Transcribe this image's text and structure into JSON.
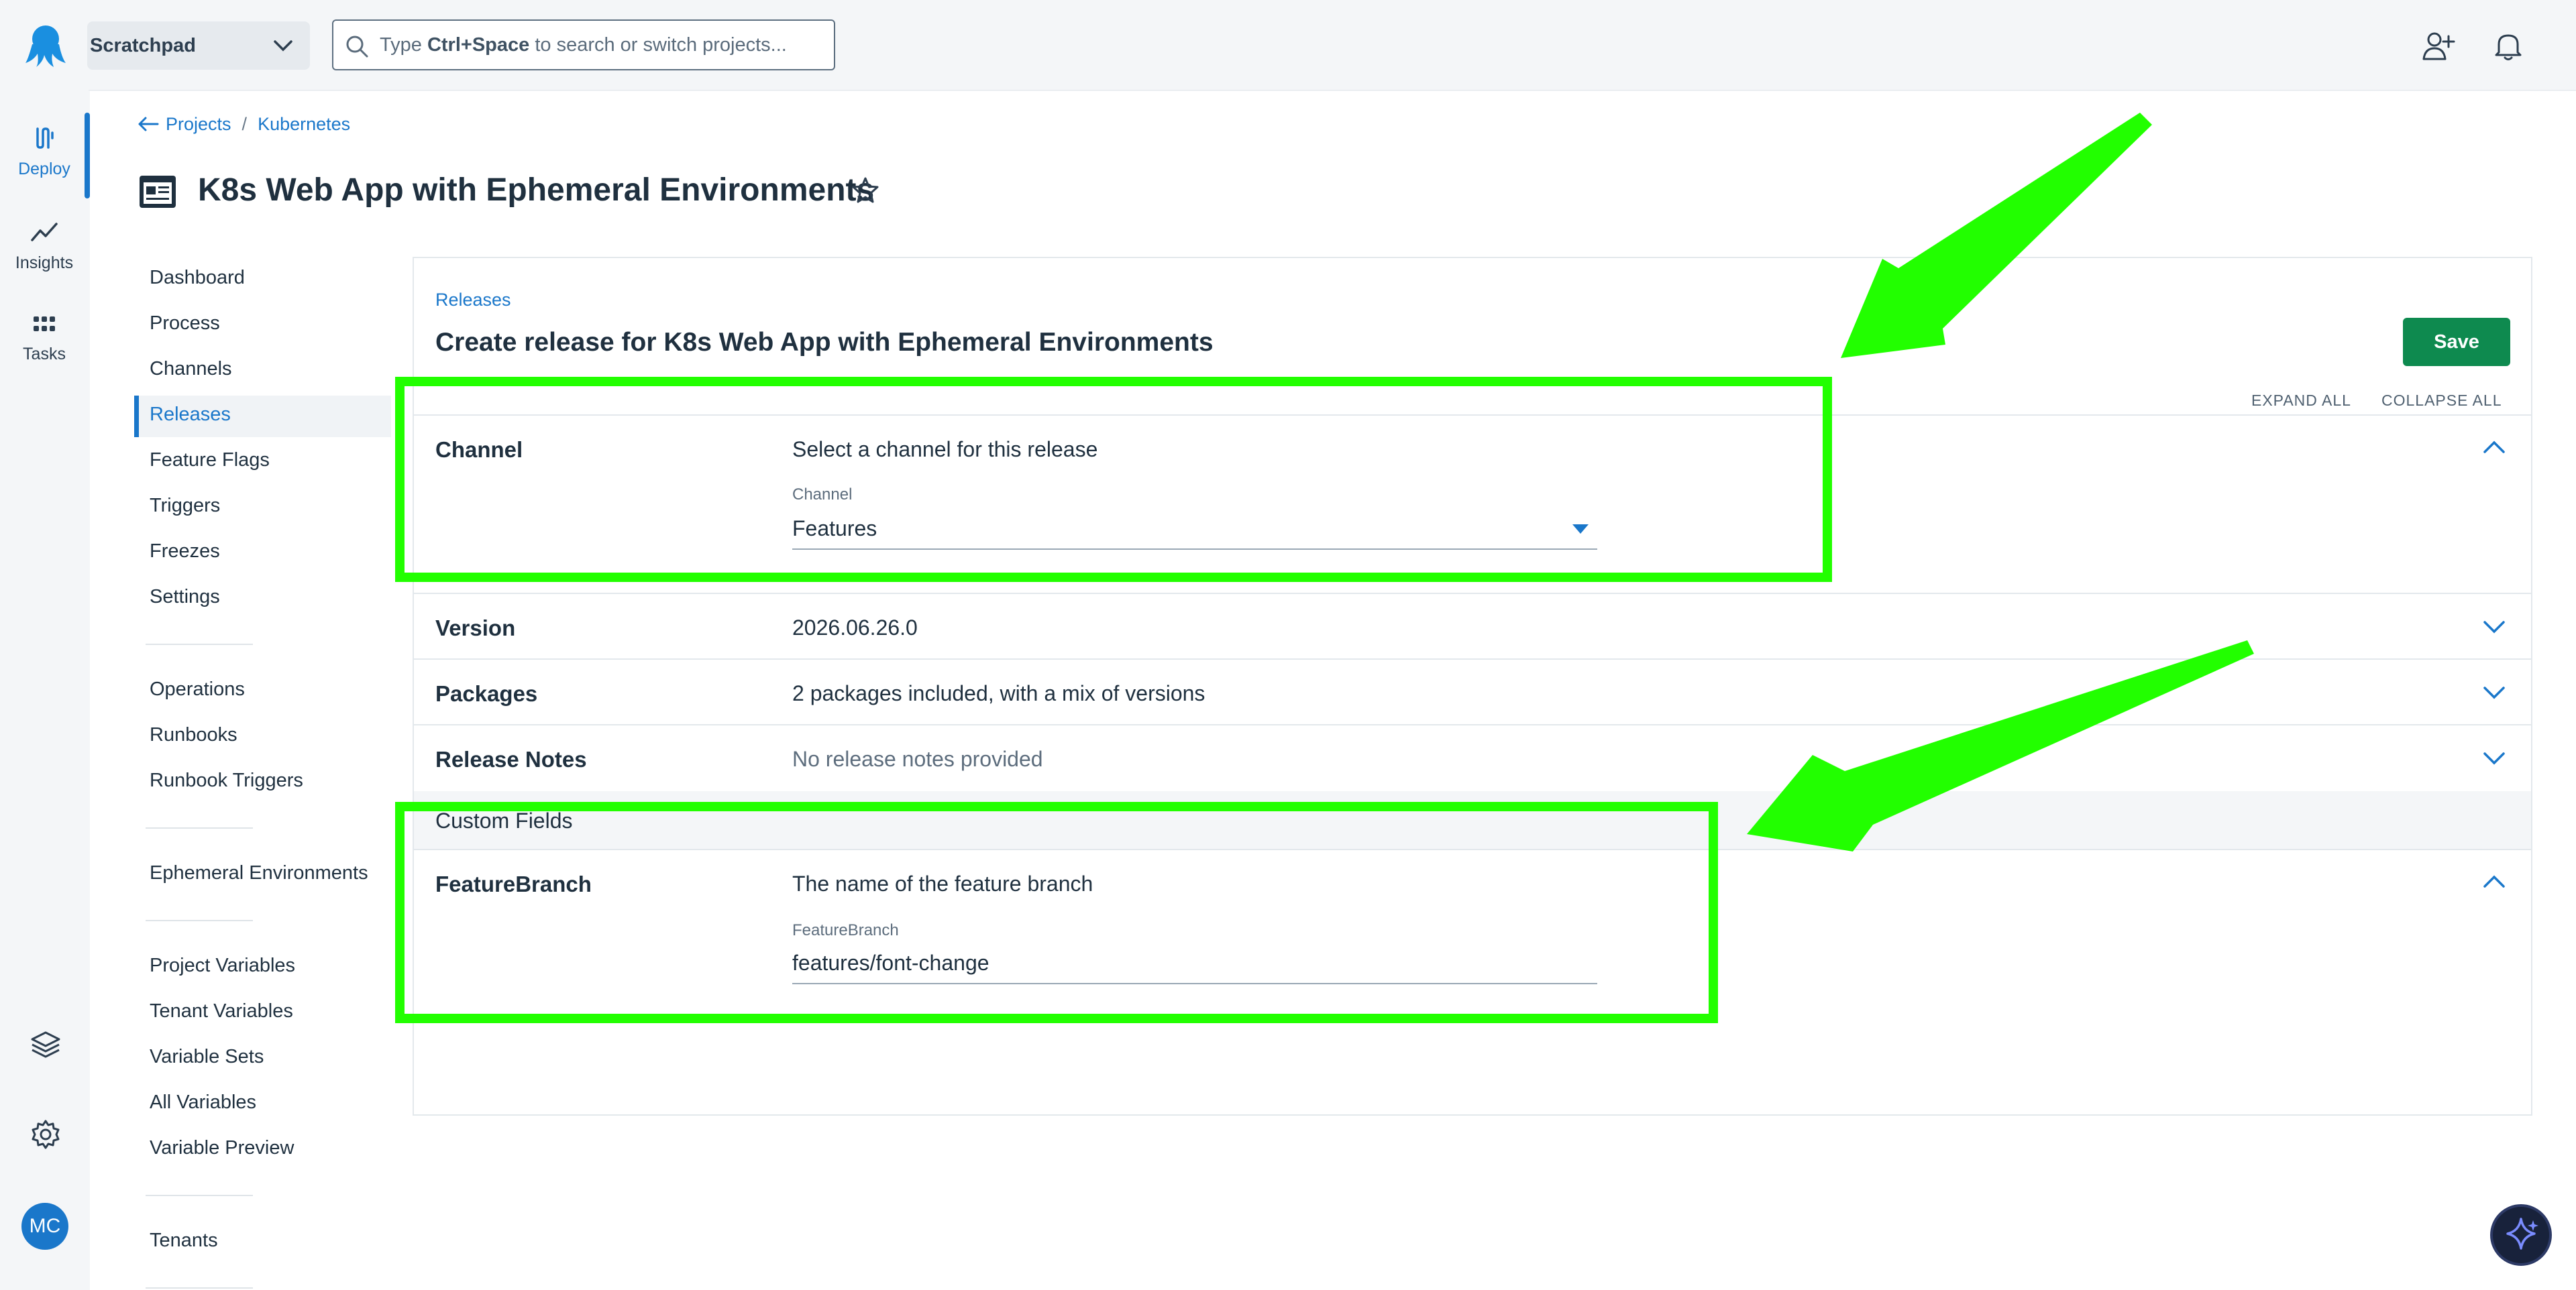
{
  "topbar": {
    "space_name": "Scratchpad",
    "search_prefix": "Type ",
    "search_shortcut": "Ctrl+Space",
    "search_suffix": " to search or switch projects..."
  },
  "rail": {
    "deploy": "Deploy",
    "insights": "Insights",
    "tasks": "Tasks",
    "avatar_initials": "MC"
  },
  "breadcrumb": {
    "projects": "Projects",
    "separator": "/",
    "current": "Kubernetes"
  },
  "page": {
    "title": "K8s Web App with Ephemeral Environments"
  },
  "nav": {
    "items": [
      "Dashboard",
      "Process",
      "Channels",
      "Releases",
      "Feature Flags",
      "Triggers",
      "Freezes",
      "Settings",
      "Operations",
      "Runbooks",
      "Runbook Triggers",
      "Ephemeral Environments",
      "Project Variables",
      "Tenant Variables",
      "Variable Sets",
      "All Variables",
      "Variable Preview",
      "Tenants"
    ],
    "active": "Releases"
  },
  "panel": {
    "crumb": "Releases",
    "title": "Create release for K8s Web App with Ephemeral Environments",
    "save_label": "Save",
    "expand_all": "EXPAND ALL",
    "collapse_all": "COLLAPSE ALL"
  },
  "sections": {
    "channel": {
      "label": "Channel",
      "description": "Select a channel for this release",
      "field_label": "Channel",
      "value": "Features"
    },
    "version": {
      "label": "Version",
      "value": "2026.06.26.0"
    },
    "packages": {
      "label": "Packages",
      "value": "2 packages included, with a mix of versions"
    },
    "release_notes": {
      "label": "Release Notes",
      "value": "No release notes provided"
    },
    "custom_fields": {
      "label": "Custom Fields"
    },
    "feature_branch": {
      "label": "FeatureBranch",
      "description": "The name of the feature branch",
      "field_label": "FeatureBranch",
      "value": "features/font-change"
    }
  },
  "colors": {
    "accent": "#1a77ca",
    "save_green": "#0e8a4f",
    "annotation_green": "#22ff00"
  }
}
